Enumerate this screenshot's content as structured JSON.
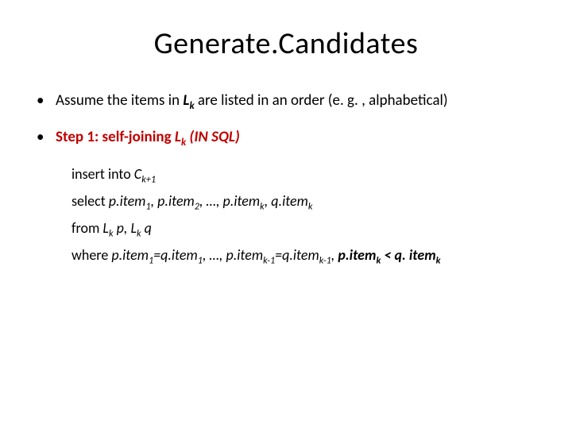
{
  "title": "Generate.Candidates",
  "bullet1": {
    "pre": "Assume the items in ",
    "sym": "L",
    "sub": "k",
    "post": " are listed in an order (e. g. , alphabetical)"
  },
  "bullet2": {
    "label": "Step 1: self-joining ",
    "sym": "L",
    "sub": "k",
    "sql": " (IN SQL)"
  },
  "sql": {
    "l1": {
      "a": "insert into ",
      "b": "C",
      "sub": "k+1"
    },
    "l2": {
      "a": "select ",
      "p1": "p.item",
      "s1": "1",
      "c1": ", ",
      "p2": "p.item",
      "s2": "2",
      "c2": ", …, ",
      "p3": "p.item",
      "s3": "k",
      "c3": ", ",
      "p4": "q.item",
      "s4": "k"
    },
    "l3": {
      "a": "from ",
      "L1": "L",
      "s1": "k",
      "p": " p, ",
      "L2": "L",
      "s2": "k",
      "q": " q"
    },
    "l4": {
      "a": "where ",
      "lhs1": "p.item",
      "ls1": "1",
      "eq1": "=",
      "rhs1": "q.item",
      "rs1": "1",
      "mid": ", …, ",
      "lhs2": "p.item",
      "ls2": "k-1",
      "eq2": "=",
      "rhs2": "q.item",
      "rs2": "k-1",
      "sep": ", ",
      "lhs3": "p.item",
      "ls3": "k",
      "lt": " < ",
      "rhs3": "q. item",
      "rs3": "k"
    }
  }
}
